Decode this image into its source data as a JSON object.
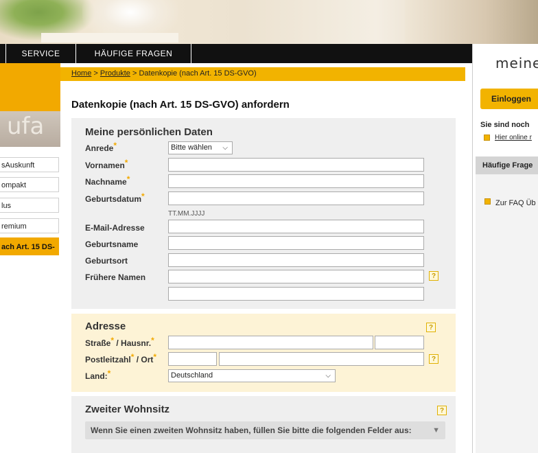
{
  "nav": {
    "items": [
      "SERVICE",
      "HÄUFIGE FRAGEN"
    ]
  },
  "breadcrumb": {
    "home": "Home",
    "sep1": " > ",
    "products": "Produkte",
    "sep2": " > ",
    "current": "Datenkopie (nach Art. 15 DS-GVO)"
  },
  "sidebar": {
    "logo_text": "ufa",
    "items": [
      {
        "label": "sAuskunft"
      },
      {
        "label": "ompakt"
      },
      {
        "label": "lus"
      },
      {
        "label": "remium"
      },
      {
        "label": "ach Art. 15 DS-"
      }
    ]
  },
  "page": {
    "title": "Datenkopie (nach Art. 15 DS-GVO) anfordern"
  },
  "personal": {
    "section_title": "Meine persönlichen Daten",
    "anrede_label": "Anrede",
    "anrede_value": "Bitte wählen",
    "vorname_label": "Vornamen",
    "nachname_label": "Nachname",
    "geburtsdatum_label": "Geburtsdatum",
    "geburtsdatum_hint": "TT.MM.JJJJ",
    "email_label": "E-Mail-Adresse",
    "geburtsname_label": "Geburtsname",
    "geburtsort_label": "Geburtsort",
    "fruehere_label": "Frühere Namen"
  },
  "address": {
    "section_title": "Adresse",
    "strasse_label": "Straße",
    "hausnr_label": " / Hausnr.",
    "plz_label": "Postleitzahl",
    "ort_label": " / Ort",
    "land_label": "Land:",
    "land_value": "Deutschland"
  },
  "second": {
    "section_title": "Zweiter Wohnsitz",
    "info": "Wenn Sie einen zweiten Wohnsitz haben, füllen Sie bitte die folgenden Felder aus:"
  },
  "right": {
    "meine": "meine",
    "login": "Einloggen",
    "status": "Sie sind noch",
    "register_link": "Hier online r",
    "faq_header": "Häufige Frage",
    "faq_link": "Zur FAQ Üb"
  },
  "glyphs": {
    "star": "*",
    "help": "?",
    "chevron": "⌵",
    "triangle": "▼"
  },
  "colors": {
    "accent": "#f2b300",
    "nav_bg": "#111111",
    "panel_grey": "#efefef",
    "panel_yellow": "#fdf3d6"
  }
}
